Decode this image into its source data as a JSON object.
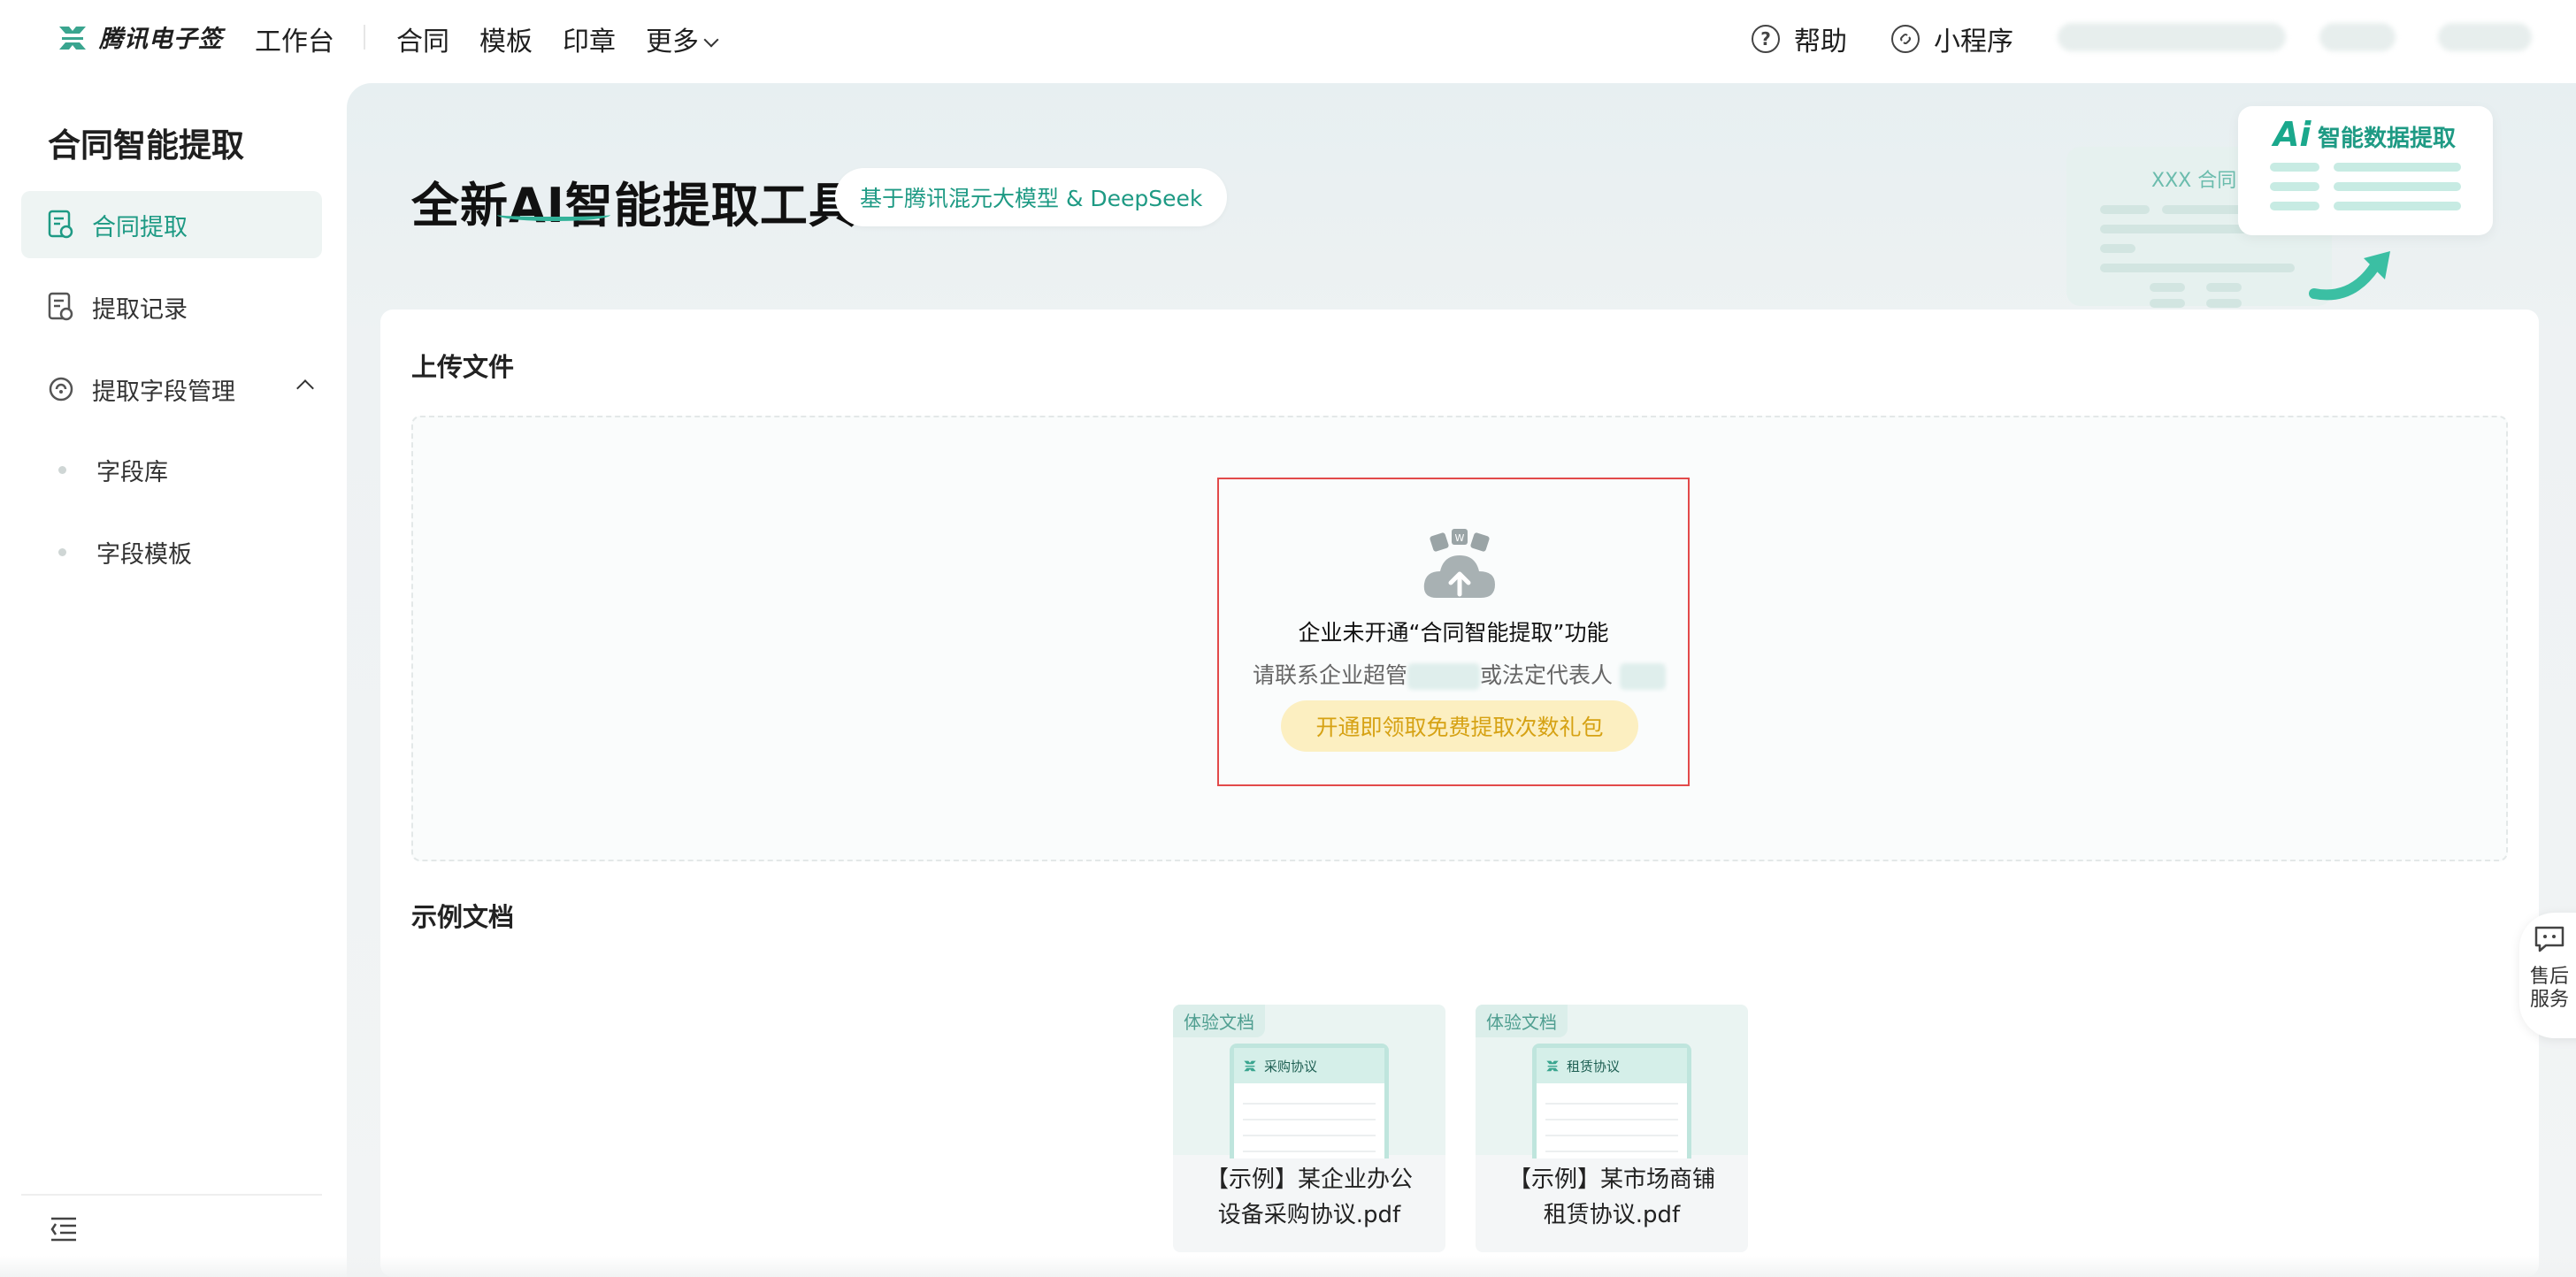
{
  "brand": {
    "name": "腾讯电子签",
    "accent": "#1e9a84"
  },
  "topnav": {
    "workbench": "工作台",
    "items": [
      "合同",
      "模板",
      "印章"
    ],
    "more": "更多",
    "help": "帮助",
    "miniprogram": "小程序"
  },
  "sidebar": {
    "title": "合同智能提取",
    "items": [
      {
        "label": "合同提取",
        "active": true
      },
      {
        "label": "提取记录",
        "active": false
      },
      {
        "label": "提取字段管理",
        "active": false
      }
    ],
    "subitems": [
      "字段库",
      "字段模板"
    ]
  },
  "hero": {
    "title": "全新AI智能提取工具",
    "badge": "基于腾讯混元大模型 & DeepSeek",
    "card_title": "智能数据提取",
    "card_logo": "Ai",
    "doc_label": "XXX 合同"
  },
  "upload": {
    "section_title": "上传文件",
    "notice_main": "企业未开通“合同智能提取”功能",
    "notice_sub_a": "请联系企业超管",
    "notice_sub_b": "或法定代表人",
    "notice_button": "开通即领取免费提取次数礼包",
    "notice_border_color": "#e24a4a"
  },
  "examples": {
    "section_title": "示例文档",
    "items": [
      {
        "tag": "体验文档",
        "doc_title": "采购协议",
        "name_line1": "【示例】某企业办公",
        "name_line2": "设备采购协议.pdf"
      },
      {
        "tag": "体验文档",
        "doc_title": "租赁协议",
        "name_line1": "【示例】某市场商铺",
        "name_line2": "租赁协议.pdf"
      }
    ]
  },
  "after_sales": {
    "line1": "售后",
    "line2": "服务"
  }
}
